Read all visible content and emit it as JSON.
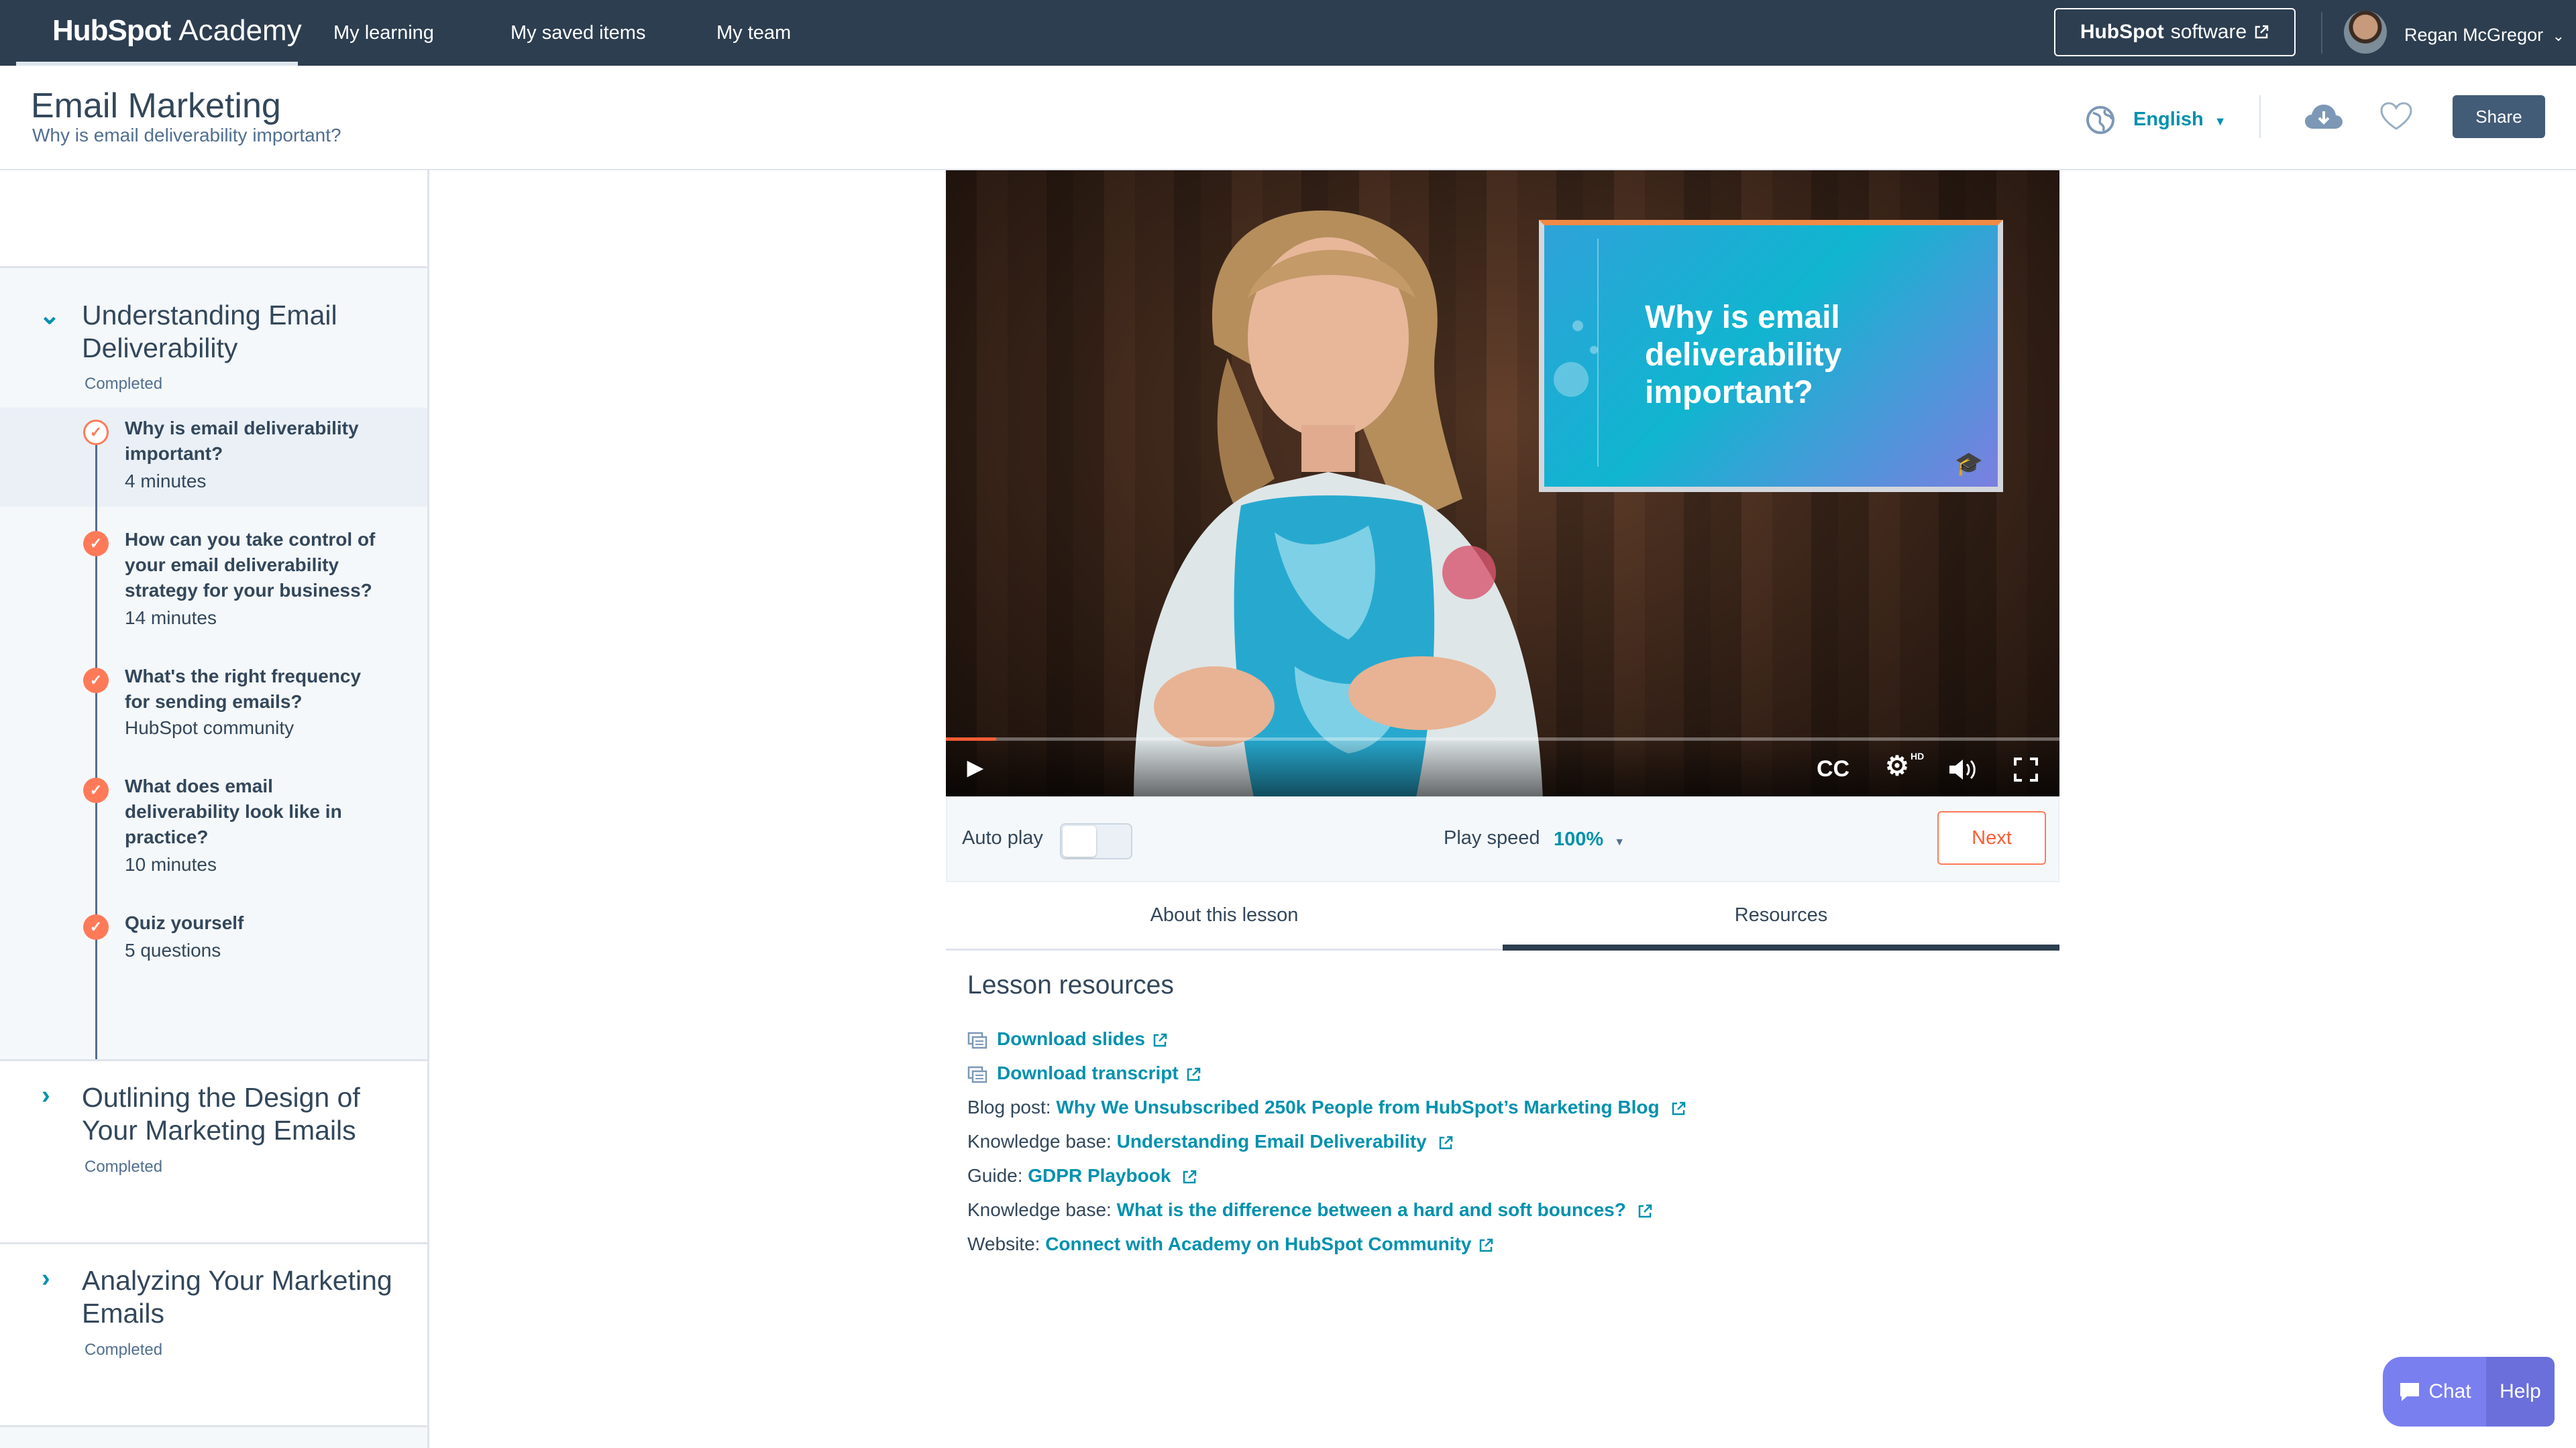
{
  "topnav": {
    "brand_primary": "HubSpot",
    "brand_secondary": "Academy",
    "links": [
      "My learning",
      "My saved items",
      "My team"
    ],
    "software_button_brand": "HubSpot",
    "software_button_label": "software",
    "user_name": "Regan McGregor"
  },
  "header": {
    "course_title": "Email Marketing",
    "lesson_subtitle": "Why is email deliverability important?",
    "language": "English",
    "share_label": "Share"
  },
  "sidebar": {
    "sections": [
      {
        "title": "Understanding Email Deliverability",
        "status": "Completed",
        "expanded": true,
        "lessons": [
          {
            "title": "Why is email deliverability important?",
            "meta": "4 minutes",
            "current": true
          },
          {
            "title": "How can you take control of your email deliverability strategy for your business?",
            "meta": "14 minutes",
            "current": false
          },
          {
            "title": "What's the right frequency for sending emails?",
            "meta": "HubSpot community",
            "current": false
          },
          {
            "title": "What does email deliverability look like in practice?",
            "meta": "10 minutes",
            "current": false
          },
          {
            "title": "Quiz yourself",
            "meta": "5 questions",
            "current": false
          }
        ]
      },
      {
        "title": "Outlining the Design of Your Marketing Emails",
        "status": "Completed",
        "expanded": false
      },
      {
        "title": "Analyzing Your Marketing Emails",
        "status": "Completed",
        "expanded": false
      }
    ]
  },
  "video": {
    "slide_text": "Why is email deliverability important?",
    "progress": 0.045,
    "cc_label": "CC",
    "hd_label": "HD"
  },
  "player": {
    "autoplay_label": "Auto play",
    "autoplay_on": false,
    "speed_label": "Play speed",
    "speed_value": "100%",
    "next_label": "Next"
  },
  "tabs": [
    {
      "label": "About this lesson",
      "active": false
    },
    {
      "label": "Resources",
      "active": true
    }
  ],
  "resources": {
    "title": "Lesson resources",
    "items": [
      {
        "prefix": "",
        "link": "Download slides",
        "icon": "document-icon"
      },
      {
        "prefix": "",
        "link": "Download transcript",
        "icon": "document-icon"
      },
      {
        "prefix": "Blog post: ",
        "link": "Why We Unsubscribed 250k People from HubSpot’s Marketing Blog"
      },
      {
        "prefix": "Knowledge base: ",
        "link": "Understanding Email Deliverability"
      },
      {
        "prefix": "Guide: ",
        "link": "GDPR Playbook"
      },
      {
        "prefix": "Knowledge base: ",
        "link": "What is the difference between a hard and soft bounces?"
      },
      {
        "prefix": "Website: ",
        "link": "Connect with Academy on HubSpot Community"
      }
    ]
  },
  "chat": {
    "chat_label": "Chat",
    "help_label": "Help"
  },
  "colors": {
    "nav": "#2d3e50",
    "accent": "#ff7a59",
    "link": "#0091ae",
    "sidebar_bg": "#f5f8fa"
  }
}
